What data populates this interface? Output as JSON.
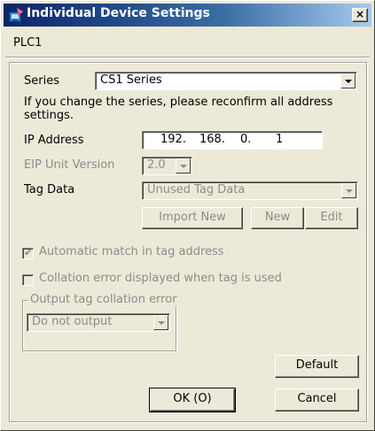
{
  "window": {
    "title": "Individual Device Settings",
    "close_label": "×"
  },
  "device": {
    "name": "PLC1"
  },
  "series": {
    "label": "Series",
    "value": "CS1 Series",
    "note": "If you change the series, please reconfirm all address settings."
  },
  "ip": {
    "label": "IP Address",
    "parts": [
      "192.",
      "168.",
      "0.",
      "1"
    ]
  },
  "eip": {
    "label": "EIP Unit Version",
    "value": "2.0"
  },
  "tag_data": {
    "label": "Tag Data",
    "value": "Unused Tag Data",
    "buttons": {
      "import_new": "Import New",
      "new": "New",
      "edit": "Edit"
    }
  },
  "options": {
    "auto_match": {
      "label": "Automatic match in tag address",
      "checked": true
    },
    "collation_error": {
      "label": "Collation error displayed when tag is used",
      "checked": false
    }
  },
  "output_collation": {
    "title": "Output tag collation error",
    "value": "Do not output"
  },
  "buttons": {
    "default": "Default",
    "ok": "OK (O)",
    "cancel": "Cancel"
  },
  "colors": {
    "title_start": "#0a246a",
    "title_end": "#a6caf0",
    "face": "#ece9d8",
    "disabled_text": "#8c8c8c"
  }
}
